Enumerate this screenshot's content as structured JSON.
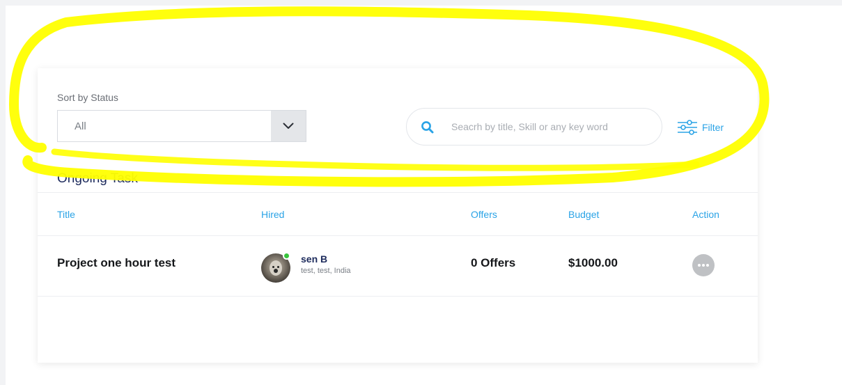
{
  "sort": {
    "label": "Sort by Status",
    "selected": "All"
  },
  "search": {
    "placeholder": "Seacrh by title, Skill or any key word",
    "value": ""
  },
  "filter": {
    "label": "Filter"
  },
  "section": {
    "title": "Ongoing Task"
  },
  "table": {
    "headers": {
      "title": "Title",
      "hired": "Hired",
      "offers": "Offers",
      "budget": "Budget",
      "action": "Action"
    },
    "rows": [
      {
        "title": "Project one hour test",
        "hired_name": "sen B",
        "hired_location": "test, test, India",
        "hired_status": "online",
        "offers": "0 Offers",
        "budget": "$1000.00",
        "action_icon": "more-horizontal-icon"
      }
    ]
  },
  "colors": {
    "accent": "#2aa3e6",
    "title_navy": "#1d2b5c",
    "online": "#37c43c",
    "highlight": "#ffff00"
  }
}
